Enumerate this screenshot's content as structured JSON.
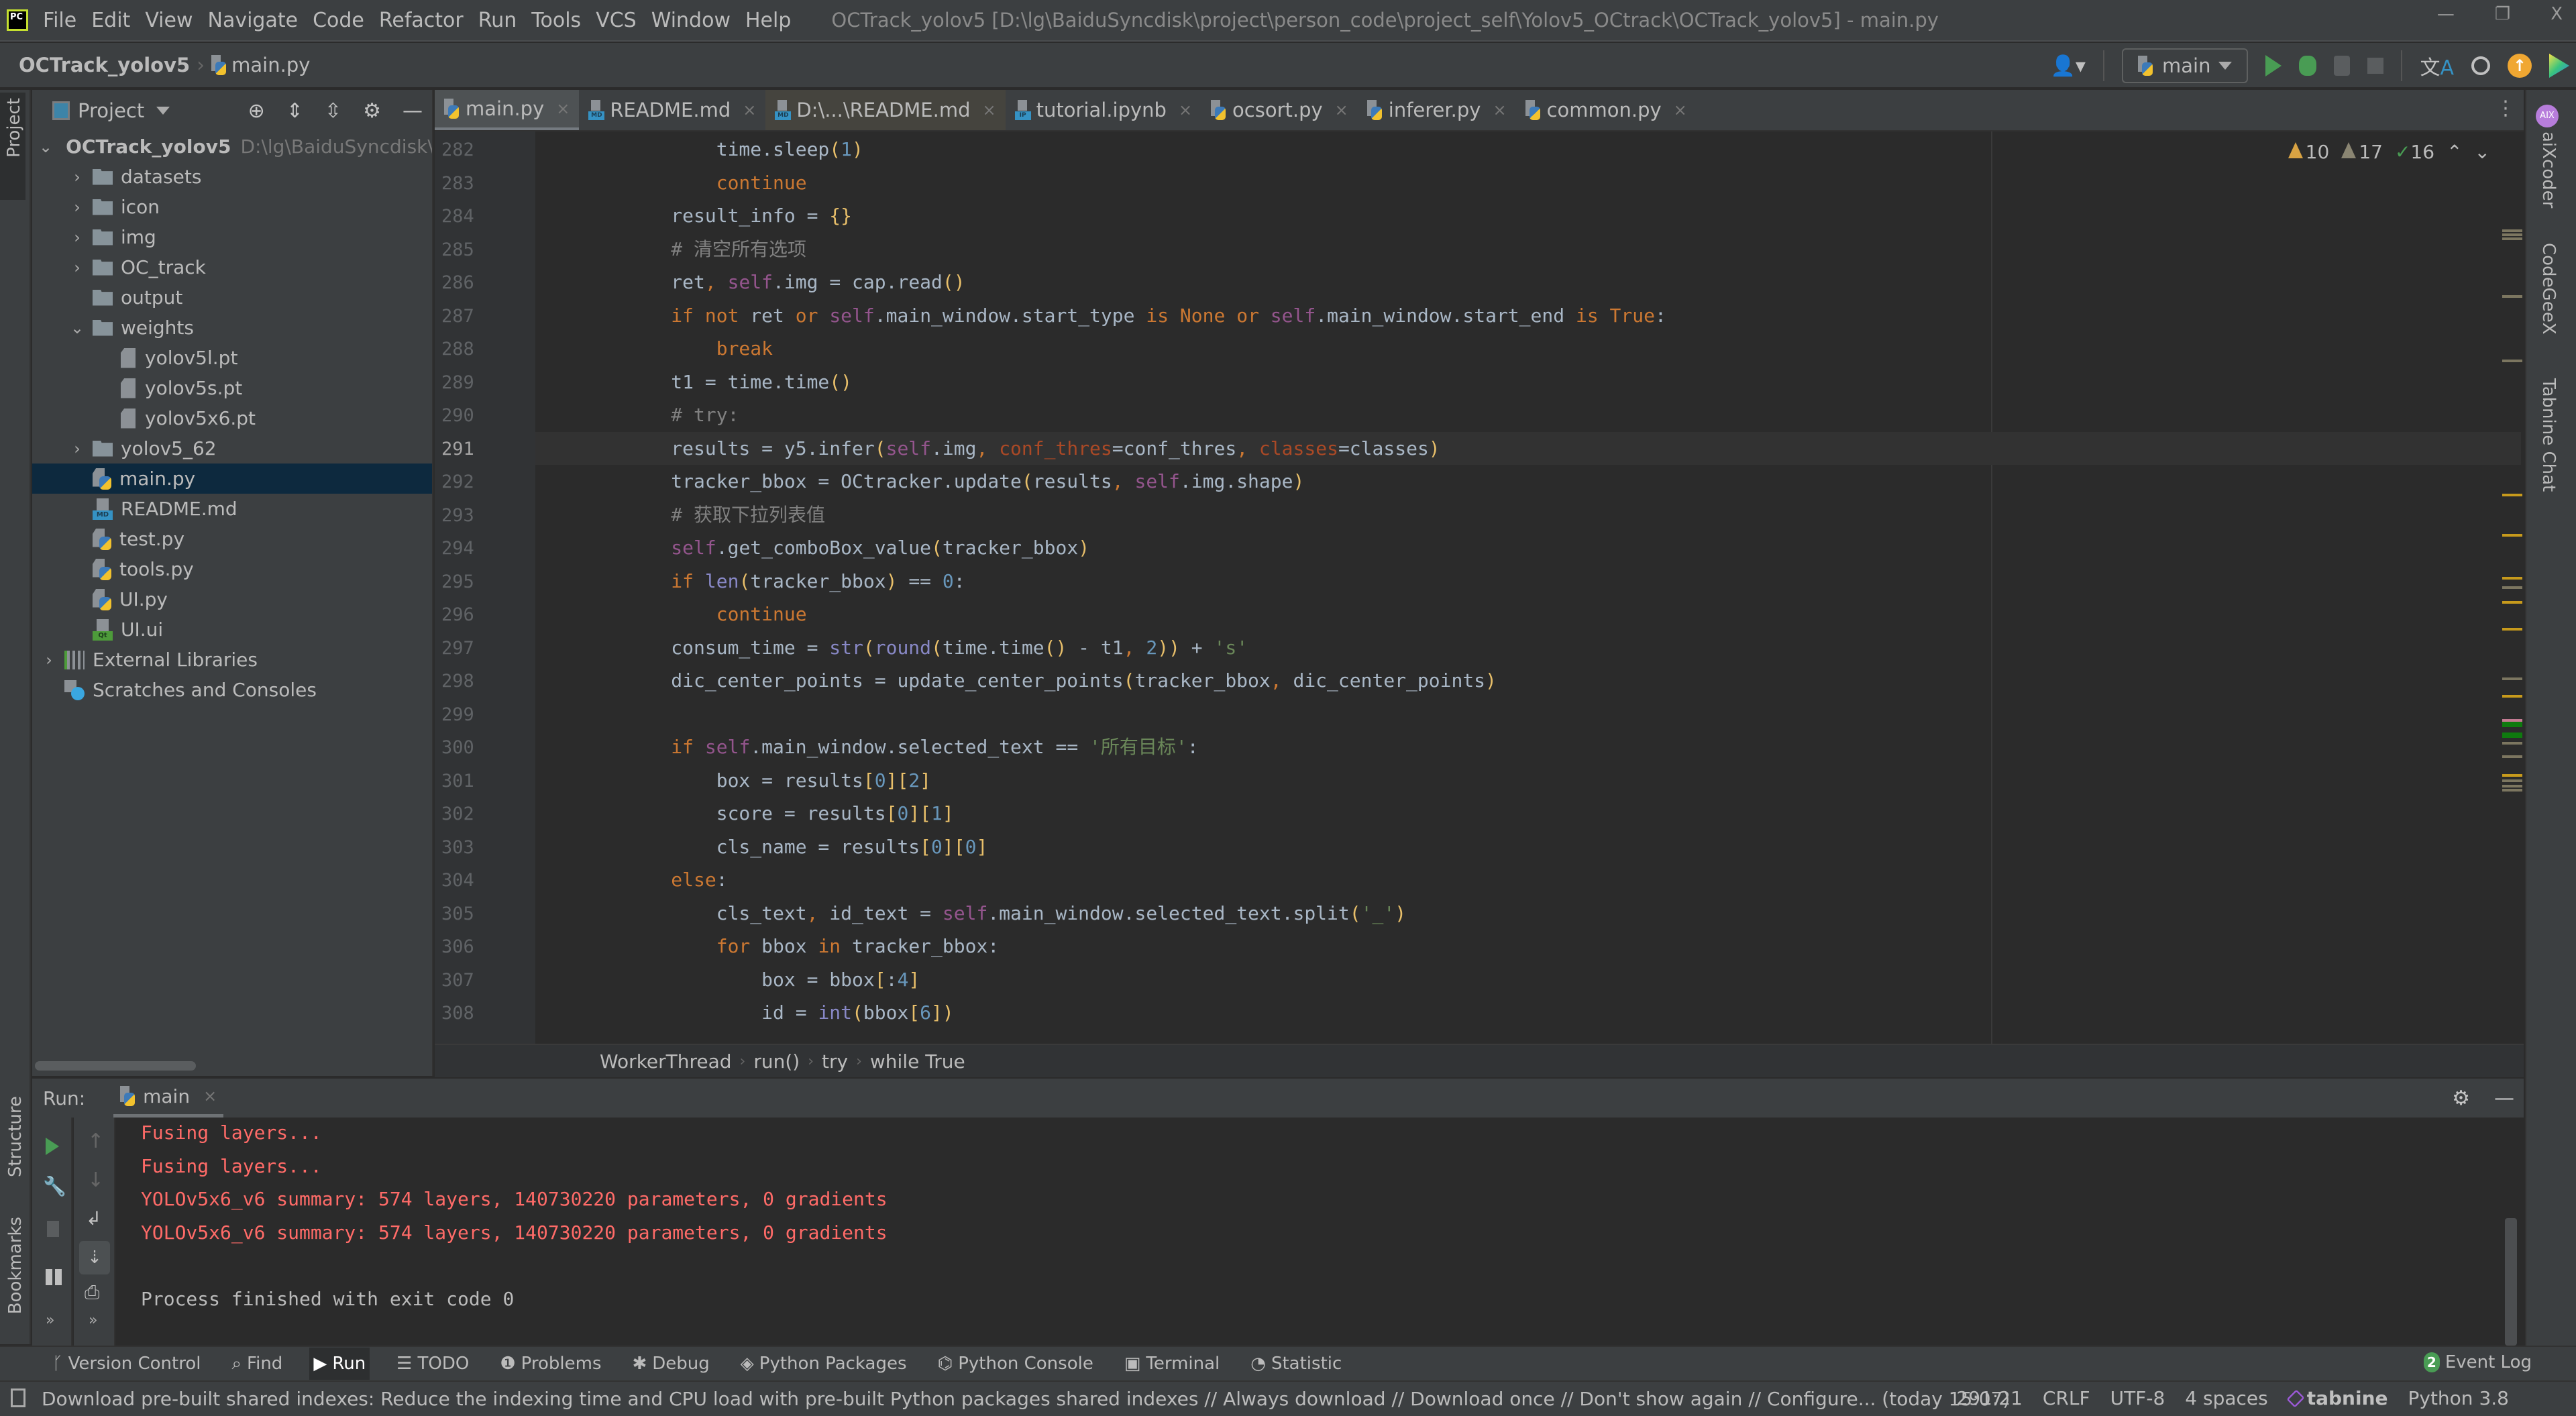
{
  "window": {
    "title": "OCTrack_yolov5 [D:\\lg\\BaiduSyncdisk\\project\\person_code\\project_self\\Yolov5_OCtrack\\OCTrack_yolov5] - main.py",
    "logo": "PC",
    "controls": {
      "minimize": "—",
      "restore": "❐",
      "close": "X"
    }
  },
  "menu": [
    "File",
    "Edit",
    "View",
    "Navigate",
    "Code",
    "Refactor",
    "Run",
    "Tools",
    "VCS",
    "Window",
    "Help"
  ],
  "navbar": {
    "project": "OCTrack_yolov5",
    "file": "main.py",
    "run_config": "main"
  },
  "project_panel": {
    "title": "Project",
    "root": {
      "name": "OCTrack_yolov5",
      "path": "D:\\lg\\BaiduSyncdisk\\"
    },
    "items": [
      {
        "name": "datasets",
        "type": "folder",
        "expanded": false
      },
      {
        "name": "icon",
        "type": "folder",
        "expanded": false
      },
      {
        "name": "img",
        "type": "folder",
        "expanded": false
      },
      {
        "name": "OC_track",
        "type": "folder",
        "expanded": false
      },
      {
        "name": "output",
        "type": "folder"
      },
      {
        "name": "weights",
        "type": "folder",
        "expanded": true
      },
      {
        "name": "yolov5l.pt",
        "type": "file"
      },
      {
        "name": "yolov5s.pt",
        "type": "file"
      },
      {
        "name": "yolov5x6.pt",
        "type": "file"
      },
      {
        "name": "yolov5_62",
        "type": "folder",
        "expanded": false
      },
      {
        "name": "main.py",
        "type": "python",
        "selected": true
      },
      {
        "name": "README.md",
        "type": "markdown"
      },
      {
        "name": "test.py",
        "type": "python"
      },
      {
        "name": "tools.py",
        "type": "python"
      },
      {
        "name": "UI.py",
        "type": "python"
      },
      {
        "name": "UI.ui",
        "type": "qt"
      }
    ],
    "external_libraries": "External Libraries",
    "scratches": "Scratches and Consoles"
  },
  "left_strip": {
    "project": "Project",
    "structure": "Structure",
    "bookmarks": "Bookmarks"
  },
  "tabs": [
    {
      "label": "main.py",
      "icon": "python",
      "active": true
    },
    {
      "label": "README.md",
      "icon": "markdown"
    },
    {
      "label": "D:\\...\\README.md",
      "icon": "markdown",
      "highlighted": true
    },
    {
      "label": "tutorial.ipynb",
      "icon": "notebook"
    },
    {
      "label": "ocsort.py",
      "icon": "python"
    },
    {
      "label": "inferer.py",
      "icon": "python"
    },
    {
      "label": "common.py",
      "icon": "python"
    }
  ],
  "inspections": {
    "warnings": "10",
    "weak_warnings": "17",
    "typos": "16"
  },
  "editor": {
    "current_line": 291,
    "line_numbers": [
      "282",
      "283",
      "284",
      "285",
      "286",
      "287",
      "288",
      "289",
      "290",
      "291",
      "292",
      "293",
      "294",
      "295",
      "296",
      "297",
      "298",
      "299",
      "300",
      "301",
      "302",
      "303",
      "304",
      "305",
      "306",
      "307",
      "308"
    ],
    "lines": [
      "            time.sleep(1)",
      "            continue",
      "        result_info = {}",
      "        # 清空所有选项",
      "        ret, self.img = cap.read()",
      "        if not ret or self.main_window.start_type is None or self.main_window.start_end is True:",
      "            break",
      "        t1 = time.time()",
      "        # try:",
      "        results = y5.infer(self.img, conf_thres=conf_thres, classes=classes)",
      "        tracker_bbox = OCtracker.update(results, self.img.shape)",
      "        # 获取下拉列表值",
      "        self.get_comboBox_value(tracker_bbox)",
      "        if len(tracker_bbox) == 0:",
      "            continue",
      "        consum_time = str(round(time.time() - t1, 2)) + 's'",
      "        dic_center_points = update_center_points(tracker_bbox, dic_center_points)",
      "",
      "        if self.main_window.selected_text == '所有目标':",
      "            box = results[0][2]",
      "            score = results[0][1]",
      "            cls_name = results[0][0]",
      "        else:",
      "            cls_text, id_text = self.main_window.selected_text.split('_')",
      "            for bbox in tracker_bbox:",
      "                box = bbox[:4]",
      "                id = int(bbox[6])"
    ]
  },
  "breadcrumb": [
    "WorkerThread",
    "run()",
    "try",
    "while True"
  ],
  "run_panel": {
    "label": "Run:",
    "tab": "main",
    "output": [
      {
        "text": "Fusing layers...",
        "type": "stderr"
      },
      {
        "text": "Fusing layers...",
        "type": "stderr"
      },
      {
        "text": "YOLOv5x6_v6 summary: 574 layers, 140730220 parameters, 0 gradients",
        "type": "stderr"
      },
      {
        "text": "YOLOv5x6_v6 summary: 574 layers, 140730220 parameters, 0 gradients",
        "type": "stderr"
      },
      {
        "text": "",
        "type": "stdout"
      },
      {
        "text": "Process finished with exit code 0",
        "type": "stdout"
      }
    ]
  },
  "tool_windows": [
    {
      "label": "Version Control",
      "icon": "vcs-icon"
    },
    {
      "label": "Find",
      "icon": "search-icon"
    },
    {
      "label": "Run",
      "icon": "play-icon",
      "active": true
    },
    {
      "label": "TODO",
      "icon": "list-icon"
    },
    {
      "label": "Problems",
      "icon": "info-icon"
    },
    {
      "label": "Debug",
      "icon": "bug-icon"
    },
    {
      "label": "Python Packages",
      "icon": "packages-icon"
    },
    {
      "label": "Python Console",
      "icon": "python-icon"
    },
    {
      "label": "Terminal",
      "icon": "terminal-icon"
    },
    {
      "label": "Statistic",
      "icon": "statistic-icon"
    }
  ],
  "event_log": {
    "count": "2",
    "label": "Event Log"
  },
  "status_bar": {
    "message": "Download pre-built shared indexes: Reduce the indexing time and CPU load with pre-built Python packages shared indexes // Always download // Download once // Don't show again // Configure... (today 15:07)",
    "position": "291:21",
    "line_sep": "CRLF",
    "encoding": "UTF-8",
    "indent": "4 spaces",
    "tabnine": "tabnine",
    "interpreter": "Python 3.8"
  },
  "right_strip": [
    "aiXcoder",
    "CodeGeeX",
    "Tabnine Chat"
  ],
  "colors": {
    "accent_green": "#499c54",
    "keyword": "#cc7832",
    "self": "#94558d",
    "error_output": "#ff6b68",
    "selection": "#0d293e"
  }
}
